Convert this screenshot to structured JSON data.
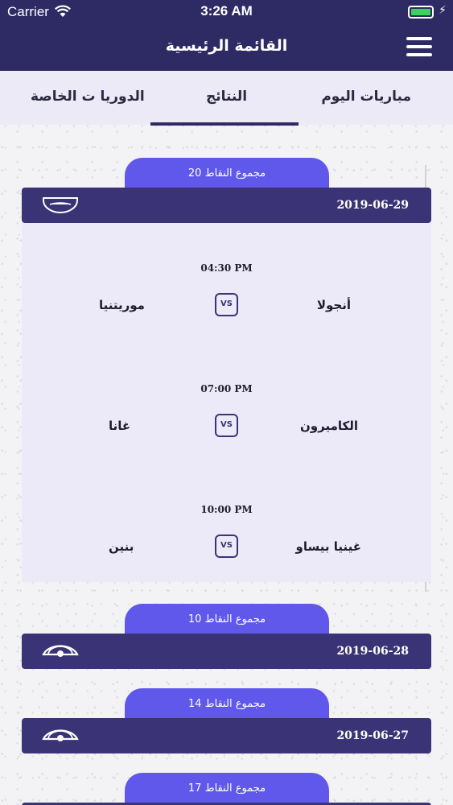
{
  "status": {
    "carrier": "Carrier",
    "time": "3:26 AM"
  },
  "header": {
    "title": "القائمة الرئيسية",
    "menu_icon": "hamburger-menu-icon"
  },
  "tabs": [
    {
      "label": "مباريات اليوم",
      "active": false
    },
    {
      "label": "النتائج",
      "active": true
    },
    {
      "label": "الدوريا ت الخاصة",
      "active": false
    }
  ],
  "groups": [
    {
      "points": "مجموع النقاط 20",
      "date": "2019-06-29",
      "icon": "bowl-closed-icon",
      "expanded": true,
      "matches": [
        {
          "time": "04:30 PM",
          "home": "أنجولا",
          "away": "موريتنيا",
          "vs": "VS"
        },
        {
          "time": "07:00 PM",
          "home": "الكاميرون",
          "away": "غانا",
          "vs": "VS"
        },
        {
          "time": "10:00 PM",
          "home": "غينيا بيساو",
          "away": "بنين",
          "vs": "VS"
        }
      ]
    },
    {
      "points": "مجموع النقاط 10",
      "date": "2019-06-28",
      "icon": "eye-icon",
      "expanded": false
    },
    {
      "points": "مجموع النقاط 14",
      "date": "2019-06-27",
      "icon": "eye-icon",
      "expanded": false
    },
    {
      "points": "مجموع النقاط 17",
      "date": "",
      "icon": "eye-icon",
      "expanded": false
    }
  ],
  "colors": {
    "header": "#2e2a64",
    "points_tab": "#5f58ea",
    "date_bar": "#3a3476",
    "battery": "#3bd35b"
  }
}
